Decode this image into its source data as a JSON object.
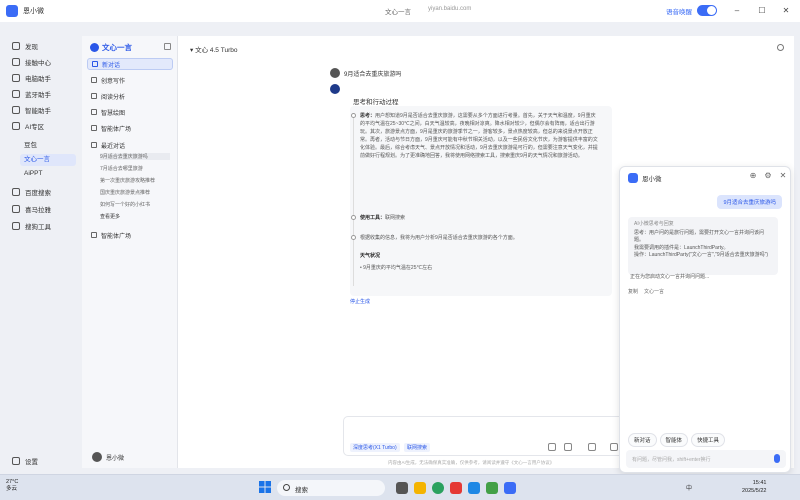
{
  "window": {
    "app_title": "恩小微",
    "center_title": "文心一言",
    "center_url": "yiyan.baidu.com",
    "toggle_label": "语音唤醒",
    "toggle_on": true
  },
  "left_nav": {
    "items": [
      {
        "label": "发现",
        "icon": "compass-icon"
      },
      {
        "label": "接触中心",
        "icon": "contact-icon"
      },
      {
        "label": "电脑助手",
        "icon": "computer-icon"
      },
      {
        "label": "蓝牙助手",
        "icon": "bluetooth-icon"
      },
      {
        "label": "智能助手",
        "icon": "robot-icon"
      },
      {
        "label": "AI专区",
        "icon": "ai-icon"
      }
    ],
    "ai_sub": [
      "豆包",
      "文心一言",
      "AiPPT"
    ],
    "ai_sub_active": 1,
    "lower_items": [
      {
        "label": "百度搜索",
        "icon": "search-icon"
      },
      {
        "label": "喜马拉雅",
        "icon": "audio-icon"
      },
      {
        "label": "搜狗工具",
        "icon": "tool-icon"
      }
    ],
    "settings_label": "设置"
  },
  "panel2": {
    "brand": "文心一言",
    "items": [
      {
        "label": "新对话",
        "active": true
      },
      {
        "label": "创意写作",
        "active": false
      },
      {
        "label": "阅读分析",
        "active": false
      },
      {
        "label": "智慧绘图",
        "active": false
      },
      {
        "label": "智能体广场",
        "active": false
      }
    ],
    "history_title": "最近对话",
    "history": [
      "9月适合去重庆旅游吗",
      "7月适合去哪里旅游",
      "第一次重庆旅游攻略推荐",
      "国庆重庆旅游景点推荐",
      "如何写一个好的小红书"
    ],
    "more": "查看更多",
    "agent_square": "智能体广场",
    "user_name": "恩小微"
  },
  "main": {
    "model": "文心 4.5 Turbo",
    "user_question": "9月适合去重庆旅游吗",
    "thinking_header": "思考和行动过程",
    "steps": [
      {
        "title": "思考：",
        "text": "用户想知道9月是否适合去重庆旅游，这需要从多个方面进行考量。首先，关于天气和温度，9月重庆的平均气温在25~30℃之间，白天气温较高，夜晚相对凉爽。降水相对较少，但偶尔会有阵雨，适合出行游玩。其次，旅游景点方面，9月是重庆的旅游季节之一，游客较多，景点热度较高，但总的来说景点开放正常。再者，活动与节日方面，9月重庆可能有中秋节相关活动，以及一些民俗文化节庆，为游客提供丰富的文化体验。最后，综合考虑天气、景点开放情况和活动，9月去重庆旅游是可行的，但需要注意天气变化，并提前做好行程规划。为了更准确地回答，我将使用网络搜索工具，搜索重庆9月的天气情况和旅游活动。"
      },
      {
        "title": "使用工具：",
        "text": "联网搜索"
      },
      {
        "title": "",
        "text": "根据收集的信息，我将为用户分析9月是否适合去重庆旅游的各个方面。"
      }
    ],
    "weather_heading": "天气状况",
    "weather_bullet": "9月重庆的平均气温在25℃左右",
    "stop_label": "停止生成",
    "input_placeholder": "",
    "chips": [
      "深度思考(X1 Turbo)",
      "联网搜索"
    ],
    "disclaimer": "内容由AI生成，无法确保真实准确，仅供参考，请阅读并遵守《文心一言用户协议》"
  },
  "assistant": {
    "title": "恩小微",
    "user_bubble": "9月适合去重庆旅游吗",
    "card_title": "AI小微思考与回复",
    "card_lines": [
      "思考：用户问的是旅行问题，需要打开文心一言并询问该问题。",
      "我需要调用的插件是：LaunchThirdParty。",
      "操作：LaunchThirdParty(\"文心一言\",\"9月适合去重庆旅游吗\")"
    ],
    "status": "正在为您启动文心一言并询问问题...",
    "tools": [
      "复制",
      "文心一言"
    ],
    "buttons": [
      "新对话",
      "智能体",
      "快捷工具"
    ],
    "input_placeholder": "有问题，尽管问我，shift+enter换行"
  },
  "taskbar": {
    "temp": "27°C",
    "weather": "多云",
    "search": "搜索",
    "tray_lang": "中",
    "time": "15:41",
    "date": "2025/5/22"
  }
}
